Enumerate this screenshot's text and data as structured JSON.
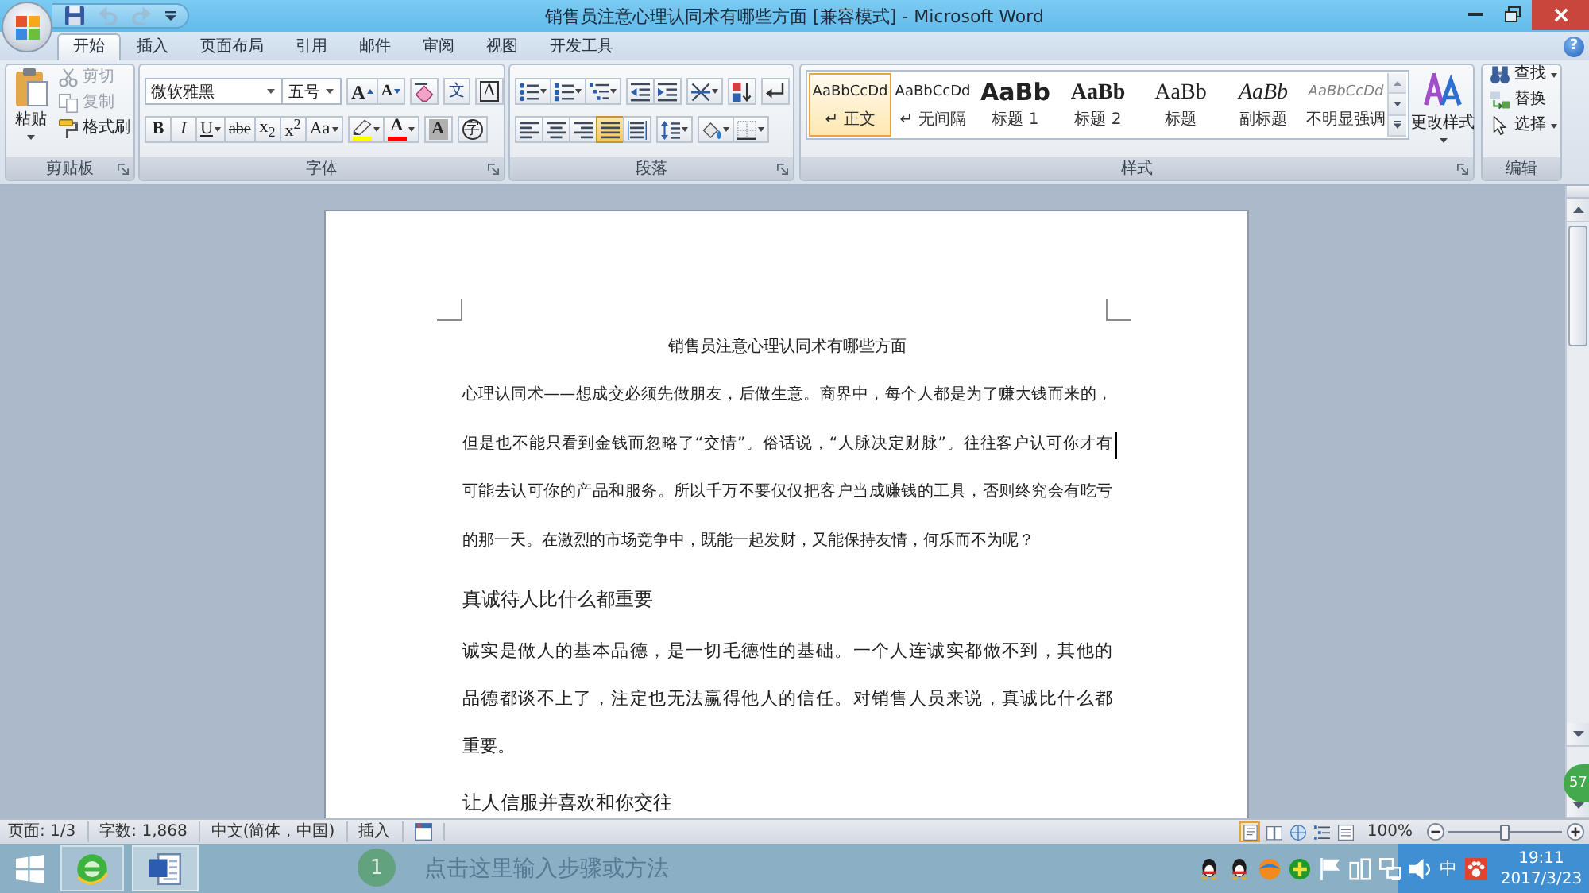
{
  "title_bar": {
    "title": "销售员注意心理认同术有哪些方面 [兼容模式] - Microsoft Word",
    "quick_access": [
      {
        "kind": "save",
        "disabled": false
      },
      {
        "kind": "undo",
        "disabled": true
      },
      {
        "kind": "redo",
        "disabled": true
      },
      {
        "kind": "customize",
        "disabled": false
      }
    ]
  },
  "tabs": [
    {
      "label": "开始",
      "selected": true
    },
    {
      "label": "插入",
      "selected": false
    },
    {
      "label": "页面布局",
      "selected": false
    },
    {
      "label": "引用",
      "selected": false
    },
    {
      "label": "邮件",
      "selected": false
    },
    {
      "label": "审阅",
      "selected": false
    },
    {
      "label": "视图",
      "selected": false
    },
    {
      "label": "开发工具",
      "selected": false
    }
  ],
  "help": "?",
  "clipboard": {
    "label": "剪贴板",
    "paste": "粘贴",
    "items": [
      {
        "kind": "cut",
        "label": "剪切",
        "disabled": true
      },
      {
        "kind": "copy",
        "label": "复制",
        "disabled": true
      },
      {
        "kind": "format_painter",
        "label": "格式刷",
        "disabled": false
      }
    ]
  },
  "font": {
    "label": "字体",
    "name": "微软雅黑",
    "size": "五号",
    "row1": [
      [
        {
          "kind": "grow",
          "label": "A"
        },
        {
          "kind": "shrink",
          "label": "A"
        }
      ],
      [
        {
          "kind": "clear"
        }
      ],
      [
        {
          "kind": "phonetic",
          "label": "文"
        }
      ],
      [
        {
          "kind": "border",
          "label": "A"
        }
      ]
    ],
    "row2": [
      [
        {
          "kind": "bold",
          "label": "B",
          "dropdown": false
        },
        {
          "kind": "italic",
          "label": "I",
          "dropdown": false
        },
        {
          "kind": "underline",
          "label": "U",
          "dropdown": true
        },
        {
          "kind": "strike",
          "label": "abe",
          "dropdown": false
        },
        {
          "kind": "subscript",
          "label": "x$_{2}$",
          "dropdown": false
        },
        {
          "kind": "superscript",
          "label": "x$^{2}$",
          "dropdown": false
        },
        {
          "kind": "case",
          "label": "Aa",
          "dropdown": true
        }
      ],
      [
        {
          "kind": "highlight",
          "color": "#ffff00",
          "dropdown": true
        },
        {
          "kind": "font_color",
          "label": "A",
          "color": "#ff0000",
          "dropdown": true
        }
      ],
      [
        {
          "kind": "shading",
          "label": "A",
          "dropdown": false
        }
      ],
      [
        {
          "kind": "enclose",
          "label": "字",
          "dropdown": false
        }
      ]
    ]
  },
  "paragraph": {
    "label": "段落",
    "row1": [
      [
        {
          "kind": "bullets",
          "dropdown": true
        },
        {
          "kind": "numbering",
          "dropdown": true
        },
        {
          "kind": "multilevel",
          "dropdown": true
        }
      ],
      [
        {
          "kind": "outdent",
          "dropdown": false
        },
        {
          "kind": "indent",
          "dropdown": false
        }
      ],
      [
        {
          "kind": "asian_layout",
          "dropdown": true
        }
      ],
      [
        {
          "kind": "sort",
          "dropdown": false
        }
      ],
      [
        {
          "kind": "marks",
          "dropdown": false
        }
      ]
    ],
    "alignment": [
      {
        "kind": "left",
        "selected": false
      },
      {
        "kind": "center",
        "selected": false
      },
      {
        "kind": "right",
        "selected": false
      },
      {
        "kind": "justify",
        "selected": true
      },
      {
        "kind": "distribute",
        "selected": false
      }
    ],
    "row2": [
      [
        {
          "kind": "line_spacing",
          "dropdown": true
        }
      ],
      [
        {
          "kind": "shading",
          "dropdown": true
        },
        {
          "kind": "borders",
          "dropdown": true
        }
      ]
    ]
  },
  "styles": {
    "label": "样式",
    "gallery": [
      {
        "kind": "normal",
        "preview": "AaBbCcDd",
        "name": "↵ 正文",
        "selected": true
      },
      {
        "kind": "no_spacing",
        "preview": "AaBbCcDd",
        "name": "↵ 无间隔",
        "selected": false
      },
      {
        "kind": "heading1",
        "preview": "AaBb",
        "name": "标题 1",
        "selected": false
      },
      {
        "kind": "heading2",
        "preview": "AaBb",
        "name": "标题 2",
        "selected": false
      },
      {
        "kind": "title",
        "preview": "AaBb",
        "name": "标题",
        "selected": false
      },
      {
        "kind": "subtitle",
        "preview": "AaBb",
        "name": "副标题",
        "selected": false
      },
      {
        "kind": "subtle",
        "preview": "AaBbCcDd",
        "name": "不明显强调",
        "selected": false
      }
    ],
    "change": "更改样式"
  },
  "editing": {
    "label": "编辑",
    "items": [
      {
        "kind": "find",
        "label": "查找",
        "dropdown": true
      },
      {
        "kind": "replace",
        "label": "替换",
        "dropdown": false
      },
      {
        "kind": "select",
        "label": "选择",
        "dropdown": true
      }
    ]
  },
  "document": {
    "title": "销售员注意心理认同术有哪些方面",
    "blocks": [
      {
        "kind": "small_paragraph",
        "lines": [
          {
            "text": "心理认同术——想成交必须先做朋友，后做生意。商界中，每个人都是为了赚大钱而来的，",
            "cursor": false
          },
          {
            "text": "但是也不能只看到金钱而忽略了“交情”。俗话说，“人脉决定财脉”。往往客户认可你才有",
            "cursor": true
          },
          {
            "text": "可能去认可你的产品和服务。所以千万不要仅仅把客户当成赚钱的工具，否则终究会有吃亏",
            "cursor": false
          },
          {
            "text": "的那一天。在激烈的市场竞争中，既能一起发财，又能保持友情，何乐而不为呢？",
            "cursor": false
          }
        ]
      },
      {
        "kind": "heading",
        "text": "真诚待人比什么都重要"
      },
      {
        "kind": "paragraph",
        "lines": [
          {
            "text": "诚实是做人的基本品德，是一切毛德性的基础。一个人连诚实都做不到，其他的",
            "cursor": false
          },
          {
            "text": "品德都谈不上了，注定也无法赢得他人的信任。对销售人员来说，真诚比什么都",
            "cursor": false
          },
          {
            "text": "重要。",
            "cursor": false
          }
        ]
      },
      {
        "kind": "heading",
        "text": "让人信服并喜欢和你交往"
      }
    ]
  },
  "status_bar": {
    "items": [
      "页面: 1/3",
      "字数: 1,868",
      "中文(简体，中国)",
      "插入"
    ],
    "views": [
      {
        "kind": "print",
        "selected": true
      },
      {
        "kind": "reading",
        "selected": false
      },
      {
        "kind": "web",
        "selected": false
      },
      {
        "kind": "outline",
        "selected": false
      },
      {
        "kind": "draft",
        "selected": false
      }
    ],
    "zoom": {
      "reading": "100%",
      "level": 0.5
    }
  },
  "taskbar": {
    "apps": [
      {
        "kind": "browser"
      },
      {
        "kind": "word_processor"
      }
    ],
    "tray": [
      {
        "kind": "penguin"
      },
      {
        "kind": "penguin"
      },
      {
        "kind": "bird"
      },
      {
        "kind": "plus"
      },
      {
        "kind": "flag"
      },
      {
        "kind": "battery"
      },
      {
        "kind": "network"
      },
      {
        "kind": "speaker"
      },
      {
        "kind": "ime",
        "label": "中"
      },
      {
        "kind": "paw"
      }
    ],
    "time": "19:11",
    "date": "2017/3/23"
  },
  "backdrop": {
    "step": "1",
    "text": "点击这里输入步骤或方法"
  },
  "side_badge": "57"
}
